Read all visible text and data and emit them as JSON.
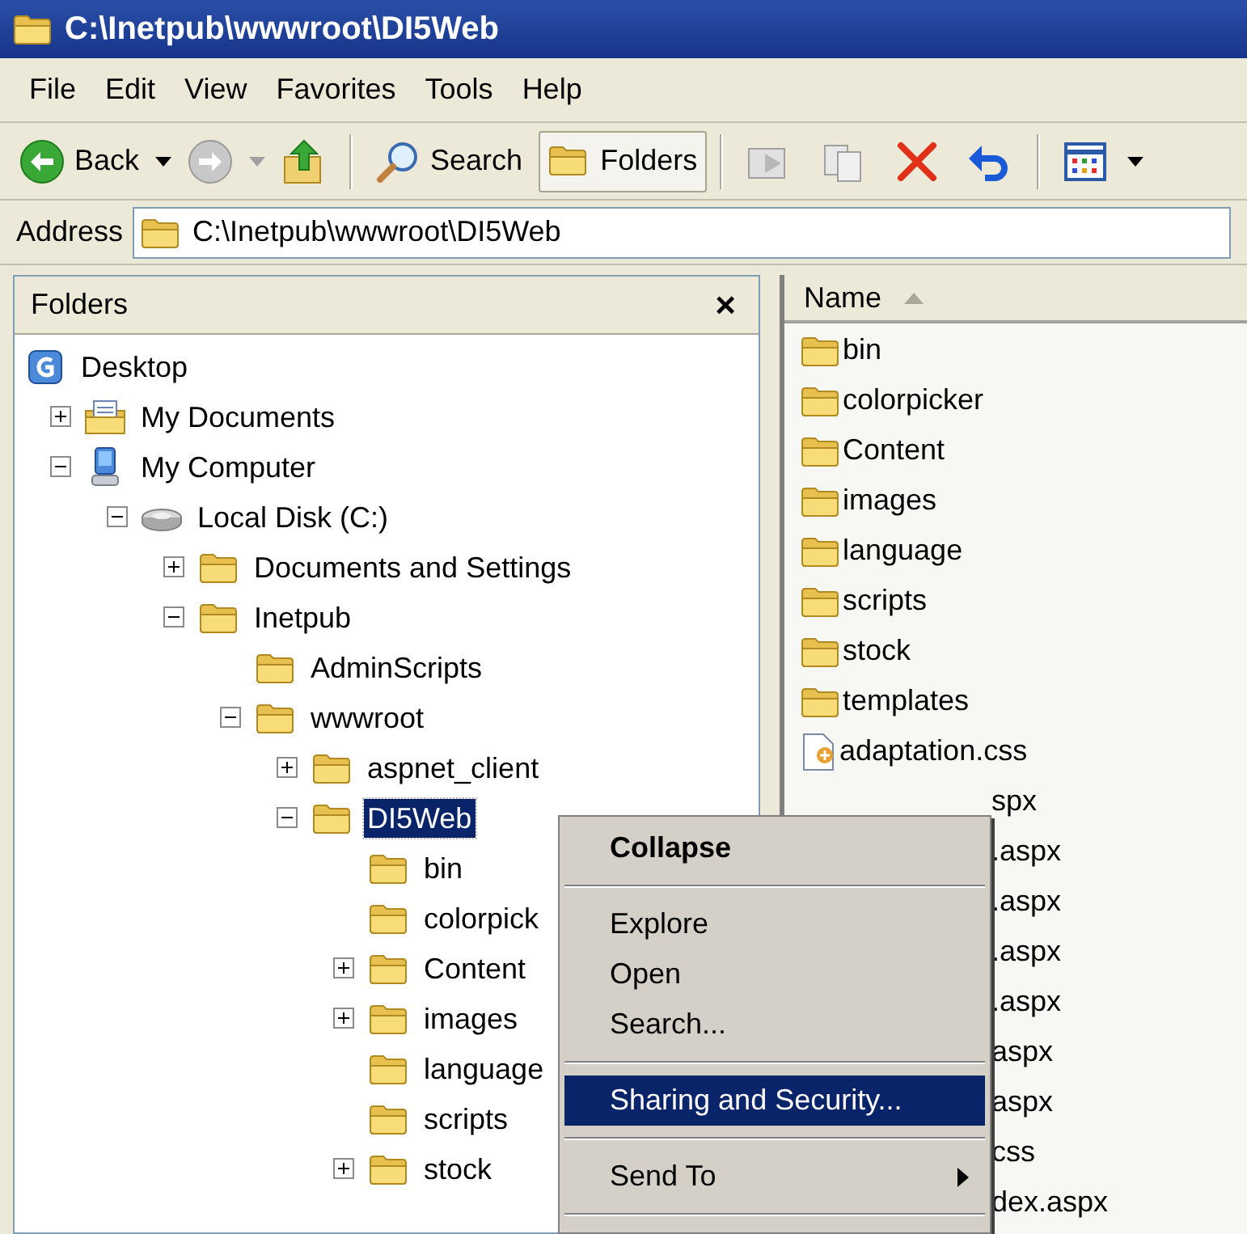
{
  "window": {
    "title": "C:\\Inetpub\\wwwroot\\DI5Web"
  },
  "menu_bar": [
    "File",
    "Edit",
    "View",
    "Favorites",
    "Tools",
    "Help"
  ],
  "toolbar": [
    {
      "kind": "back",
      "label": "Back",
      "pressed": false
    },
    {
      "kind": "forward",
      "pressed": false
    },
    {
      "kind": "up",
      "pressed": false
    },
    {
      "kind": "separator"
    },
    {
      "kind": "search",
      "label": "Search",
      "pressed": false
    },
    {
      "kind": "folders",
      "label": "Folders",
      "pressed": true
    },
    {
      "kind": "separator"
    },
    {
      "kind": "move",
      "pressed": false
    },
    {
      "kind": "copy",
      "pressed": false
    },
    {
      "kind": "delete",
      "pressed": false
    },
    {
      "kind": "undo",
      "pressed": false
    },
    {
      "kind": "separator"
    },
    {
      "kind": "views",
      "pressed": false
    }
  ],
  "address_bar": {
    "label": "Address",
    "value": "C:\\Inetpub\\wwwroot\\DI5Web"
  },
  "folders_pane": {
    "title": "Folders",
    "close": "×",
    "tree": [
      {
        "label": "Desktop",
        "kind": "desktop",
        "selected": false,
        "children": [
          {
            "label": "My Documents",
            "kind": "documents",
            "expanded": false,
            "selected": false
          },
          {
            "label": "My Computer",
            "kind": "computer",
            "expanded": true,
            "selected": false,
            "children": [
              {
                "label": "Local Disk (C:)",
                "kind": "disk",
                "expanded": true,
                "selected": false,
                "children": [
                  {
                    "label": "Documents and Settings",
                    "kind": "folder",
                    "expanded": false,
                    "selected": false
                  },
                  {
                    "label": "Inetpub",
                    "kind": "folder",
                    "expanded": true,
                    "selected": false,
                    "children": [
                      {
                        "label": "AdminScripts",
                        "kind": "folder",
                        "selected": false
                      },
                      {
                        "label": "wwwroot",
                        "kind": "folder",
                        "expanded": true,
                        "selected": false,
                        "children": [
                          {
                            "label": "aspnet_client",
                            "kind": "folder",
                            "expanded": false,
                            "selected": false
                          },
                          {
                            "label": "DI5Web",
                            "kind": "folder",
                            "expanded": true,
                            "selected": true,
                            "children": [
                              {
                                "label": "bin",
                                "kind": "folder",
                                "selected": false
                              },
                              {
                                "label": "colorpick",
                                "kind": "folder",
                                "selected": false
                              },
                              {
                                "label": "Content",
                                "kind": "folder",
                                "expanded": false,
                                "selected": false
                              },
                              {
                                "label": "images",
                                "kind": "folder",
                                "expanded": false,
                                "selected": false
                              },
                              {
                                "label": "language",
                                "kind": "folder",
                                "selected": false
                              },
                              {
                                "label": "scripts",
                                "kind": "folder",
                                "selected": false
                              },
                              {
                                "label": "stock",
                                "kind": "folder",
                                "expanded": false,
                                "selected": false
                              }
                            ]
                          }
                        ]
                      }
                    ]
                  }
                ]
              }
            ]
          }
        ]
      }
    ]
  },
  "file_list": {
    "columns": [
      {
        "label": "Name",
        "sort_ascending": true
      }
    ],
    "rows": [
      {
        "name": "bin",
        "kind": "folder"
      },
      {
        "name": "colorpicker",
        "kind": "folder"
      },
      {
        "name": "Content",
        "kind": "folder"
      },
      {
        "name": "images",
        "kind": "folder"
      },
      {
        "name": "language",
        "kind": "folder"
      },
      {
        "name": "scripts",
        "kind": "folder"
      },
      {
        "name": "stock",
        "kind": "folder"
      },
      {
        "name": "templates",
        "kind": "folder"
      },
      {
        "name": "adaptation.css",
        "kind": "css"
      },
      {
        "name": "spx",
        "kind": "covered"
      },
      {
        "name": ".aspx",
        "kind": "covered"
      },
      {
        "name": ".aspx",
        "kind": "covered"
      },
      {
        "name": ".aspx",
        "kind": "covered"
      },
      {
        "name": ".aspx",
        "kind": "covered"
      },
      {
        "name": "aspx",
        "kind": "covered"
      },
      {
        "name": "aspx",
        "kind": "covered"
      },
      {
        "name": "css",
        "kind": "covered"
      },
      {
        "name": "dex.aspx",
        "kind": "covered"
      }
    ]
  },
  "context_menu": [
    {
      "kind": "item",
      "label": "Collapse",
      "bold": true,
      "selected": false
    },
    {
      "kind": "separator"
    },
    {
      "kind": "item",
      "label": "Explore",
      "bold": false,
      "selected": false
    },
    {
      "kind": "item",
      "label": "Open",
      "bold": false,
      "selected": false
    },
    {
      "kind": "item",
      "label": "Search...",
      "bold": false,
      "selected": false
    },
    {
      "kind": "separator"
    },
    {
      "kind": "item",
      "label": "Sharing and Security...",
      "bold": false,
      "selected": true
    },
    {
      "kind": "separator"
    },
    {
      "kind": "submenu",
      "label": "Send To",
      "bold": false,
      "selected": false
    },
    {
      "kind": "separator"
    }
  ]
}
